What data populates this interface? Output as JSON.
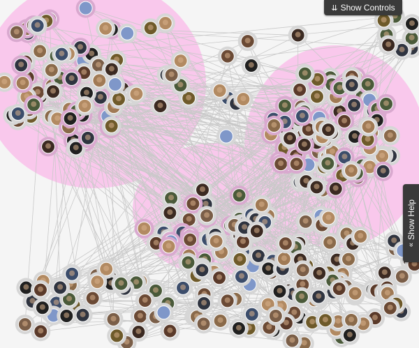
{
  "controls": {
    "show_controls_label": "Show Controls"
  },
  "help": {
    "show_help_label": "Show Help"
  },
  "icons": {
    "controls_chevron": "double-chevron-down-icon",
    "help_chevron": "double-chevron-left-icon"
  },
  "colors": {
    "background": "#f5f5f5",
    "cluster_fill": "#f9c8ec",
    "edge": "#c9c9c9",
    "node_ring": "#d6d6d6",
    "node_ring_highlight": "#d9a9cf",
    "tab_bg": "#3a3a3a",
    "empty_node": "#7f97c9"
  }
}
